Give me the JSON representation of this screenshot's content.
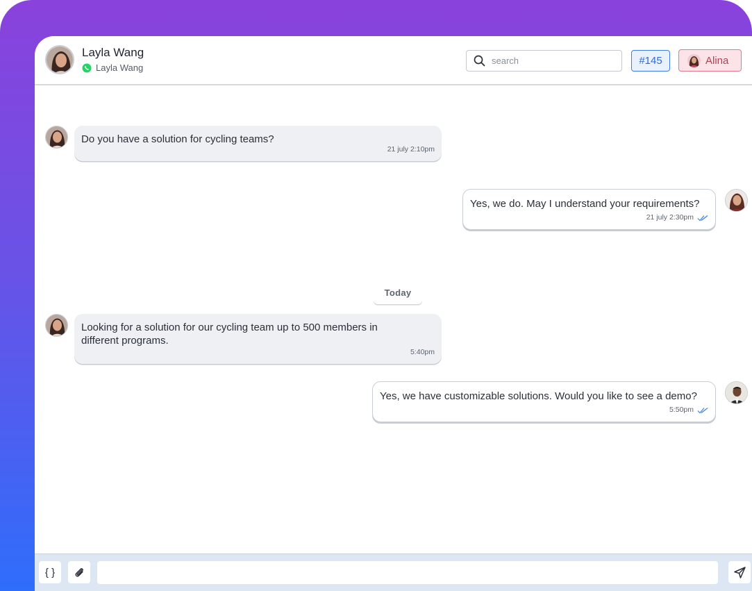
{
  "header": {
    "contact_name": "Layla Wang",
    "contact_channel_name": "Layla Wang",
    "channel_icon": "whatsapp-icon",
    "search_placeholder": "search",
    "ticket_label": "#145",
    "agent_name": "Alina"
  },
  "messages": [
    {
      "direction": "incoming",
      "text": "Do you have a solution for cycling teams?",
      "time": "21 july 2:10pm"
    },
    {
      "direction": "outgoing",
      "text": "Yes, we do. May I understand your requirements?",
      "time": "21 july 2:30pm",
      "status_icon": "double-check-icon"
    },
    {
      "direction": "incoming",
      "text": "Looking for a solution for our cycling team up to 500 members in different programs.",
      "time": "5:40pm"
    },
    {
      "direction": "outgoing",
      "text": "Yes, we have customizable solutions. Would you like to see a demo?",
      "time": "5:50pm",
      "status_icon": "double-check-icon"
    }
  ],
  "date_divider": "Today",
  "composer": {
    "variables_label": "{ }",
    "attach_icon": "paperclip-icon",
    "send_icon": "send-icon",
    "input_value": ""
  },
  "colors": {
    "gradient_top": "#8a42dc",
    "gradient_bottom": "#2f6dfb",
    "ticket_accent": "#3d7ee0",
    "agent_accent": "#e3788e",
    "read_tick": "#3d7ee0",
    "whatsapp_green": "#25d366"
  }
}
